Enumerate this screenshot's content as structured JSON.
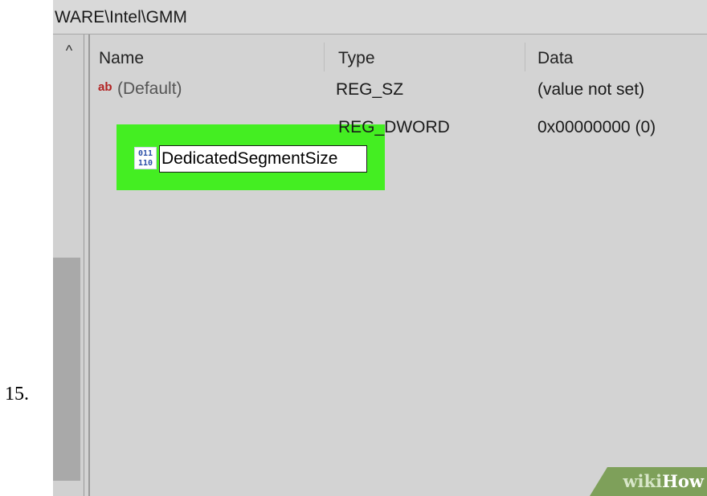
{
  "step": {
    "number": "15."
  },
  "address": {
    "path": "WARE\\Intel\\GMM"
  },
  "tree": {
    "scroll_up_glyph": "^"
  },
  "columns": {
    "name": "Name",
    "type": "Type",
    "data": "Data"
  },
  "rows": [
    {
      "icon": "ab-string-icon",
      "name": "(Default)",
      "type": "REG_SZ",
      "data": "(value not set)"
    },
    {
      "icon": "dword-binary-icon",
      "name": "DedicatedSegmentSize",
      "type": "REG_DWORD",
      "data": "0x00000000 (0)"
    }
  ],
  "icons": {
    "string_glyph": "ab",
    "dword_glyph": "011\n110"
  },
  "watermark": {
    "part1": "wiki",
    "part2": "How"
  },
  "colors": {
    "highlight": "#44ee22",
    "watermark_bg": "#7ea05a"
  }
}
